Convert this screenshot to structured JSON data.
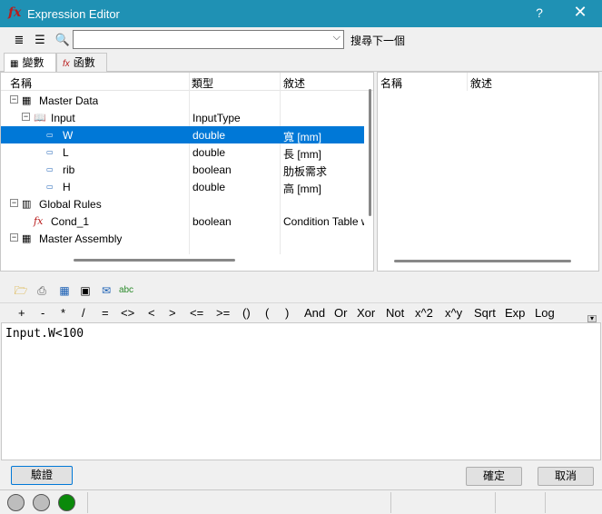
{
  "window": {
    "title": "Expression Editor",
    "help": "?",
    "close": "✕"
  },
  "toolbar": {
    "search_value": "",
    "search_next_label": "搜尋下一個"
  },
  "tabs": [
    {
      "label": "變數"
    },
    {
      "label": "函數"
    }
  ],
  "tree": {
    "columns": [
      "名稱",
      "類型",
      "敘述"
    ],
    "rows": [
      {
        "name": "Master Data",
        "type": "",
        "desc": ""
      },
      {
        "name": "Input",
        "type": "InputType",
        "desc": ""
      },
      {
        "name": "W",
        "type": "double",
        "desc": "寬 [mm]"
      },
      {
        "name": "L",
        "type": "double",
        "desc": "長 [mm]"
      },
      {
        "name": "rib",
        "type": "boolean",
        "desc": "肋板需求"
      },
      {
        "name": "H",
        "type": "double",
        "desc": "高 [mm]"
      },
      {
        "name": "Global Rules",
        "type": "",
        "desc": ""
      },
      {
        "name": "Cond_1",
        "type": "boolean",
        "desc": "Condition Table w"
      },
      {
        "name": "Master Assembly",
        "type": "",
        "desc": ""
      }
    ],
    "selected_index": 2
  },
  "right_panel": {
    "columns": [
      "名稱",
      "敘述"
    ]
  },
  "operators": [
    "+",
    "-",
    "*",
    "/",
    "=",
    "<>",
    "<",
    ">",
    "<=",
    ">=",
    "()",
    "(",
    ")",
    "And",
    "Or",
    "Xor",
    "Not",
    "x^2",
    "x^y",
    "Sqrt",
    "Exp",
    "Log"
  ],
  "expression": "Input.W<100",
  "buttons": {
    "validate": "驗證",
    "ok": "確定",
    "cancel": "取消"
  },
  "status": {
    "leds": [
      "gray",
      "gray",
      "green"
    ]
  },
  "colors": {
    "titlebar": "#1f91b4",
    "selected_row": "#0078d7",
    "led_green": "#0a8a0a",
    "led_gray": "#bdbdbd"
  },
  "icons": {
    "app": "fx-icon",
    "list_view": "list-icon",
    "tree_view": "tree-icon",
    "search": "magnifier-icon",
    "expr_tools": [
      "open-folder-icon",
      "print-icon",
      "table-icon",
      "grid-icon",
      "check-icon",
      "spellcheck-icon"
    ]
  }
}
